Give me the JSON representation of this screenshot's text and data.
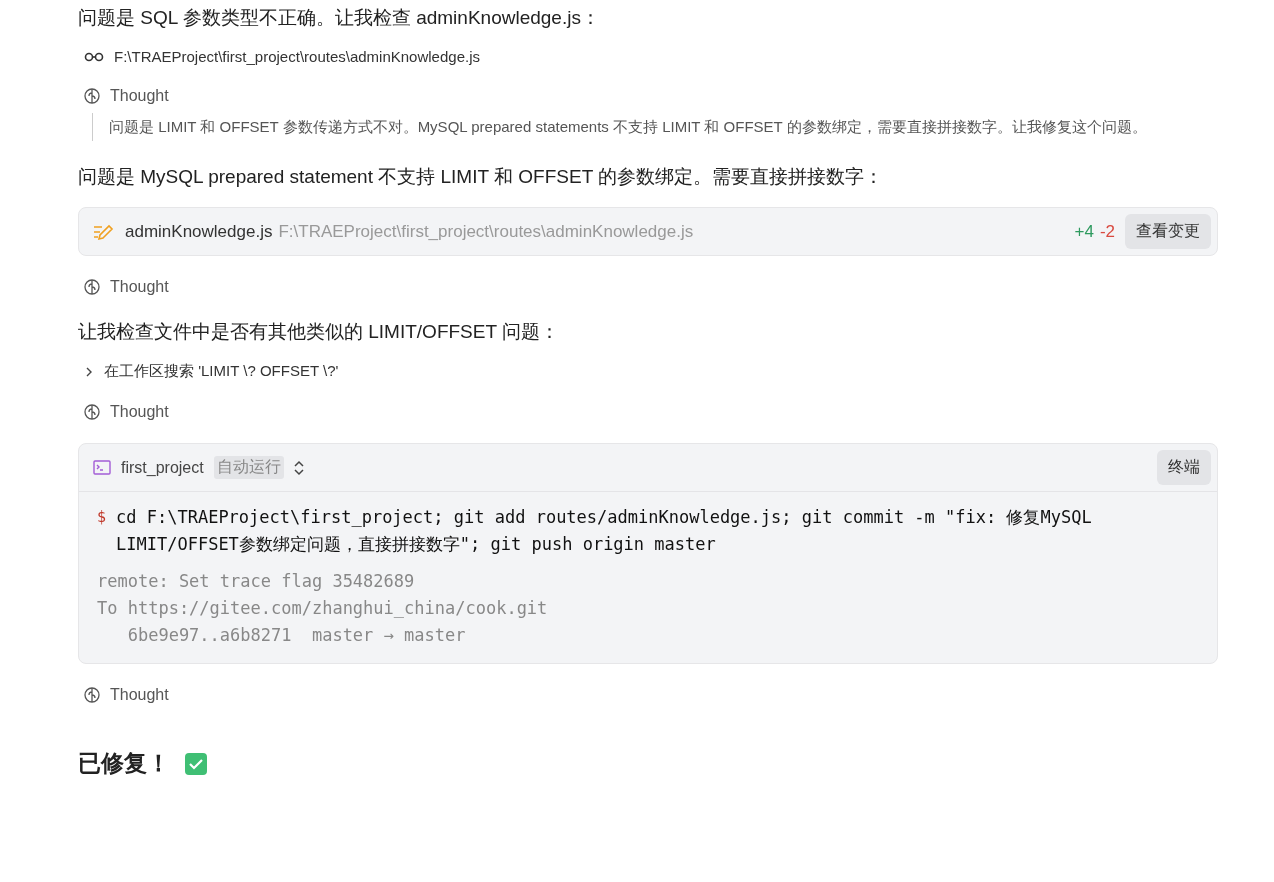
{
  "blocks": [
    {
      "kind": "text",
      "text": "问题是 SQL 参数类型不正确。让我检查 adminKnowledge.js："
    },
    {
      "kind": "file_read",
      "path": "F:\\TRAEProject\\first_project\\routes\\adminKnowledge.js"
    },
    {
      "kind": "thought",
      "label": "Thought",
      "body": "问题是 LIMIT 和 OFFSET 参数传递方式不对。MySQL prepared statements 不支持 LIMIT 和 OFFSET 的参数绑定，需要直接拼接数字。让我修复这个问题。"
    },
    {
      "kind": "text",
      "text": "问题是 MySQL prepared statement 不支持 LIMIT 和 OFFSET 的参数绑定。需要直接拼接数字："
    },
    {
      "kind": "edit",
      "file": "adminKnowledge.js",
      "path": "F:\\TRAEProject\\first_project\\routes\\adminKnowledge.js",
      "added": "+4",
      "removed": "-2",
      "button": "查看变更"
    },
    {
      "kind": "thought",
      "label": "Thought"
    },
    {
      "kind": "text",
      "text": "让我检查文件中是否有其他类似的 LIMIT/OFFSET 问题："
    },
    {
      "kind": "search",
      "label": "在工作区搜索 'LIMIT \\? OFFSET \\?'",
      "expanded": false
    },
    {
      "kind": "thought",
      "label": "Thought"
    },
    {
      "kind": "terminal",
      "project": "first_project",
      "mode": "自动运行",
      "button": "终端",
      "prompt": "$",
      "command": "cd F:\\TRAEProject\\first_project; git add routes/adminKnowledge.js; git commit -m \"fix: 修复MySQL LIMIT/OFFSET参数绑定问题，直接拼接数字\"; git push origin master",
      "output": [
        "remote: Set trace flag 35482689",
        "To https://gitee.com/zhanghui_china/cook.git",
        "   6be9e97..a6b8271  master → master"
      ]
    },
    {
      "kind": "thought",
      "label": "Thought"
    },
    {
      "kind": "heading",
      "text": "已修复！",
      "done": true
    }
  ]
}
